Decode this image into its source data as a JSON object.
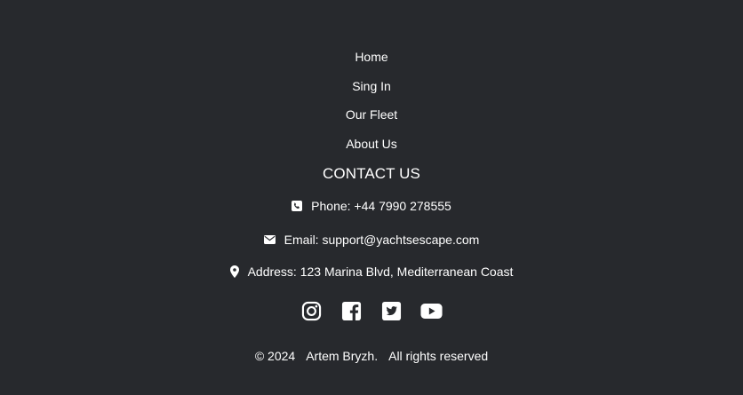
{
  "nav": {
    "items": [
      {
        "label": "Home"
      },
      {
        "label": "Sing In"
      },
      {
        "label": "Our Fleet"
      },
      {
        "label": "About Us"
      }
    ]
  },
  "contact": {
    "title": "CONTACT US",
    "phone": "Phone: +44 7990 278555",
    "email": "Email: support@yachtsescape.com",
    "address": "Address: 123 Marina Blvd, Mediterranean Coast"
  },
  "social": {
    "icons": [
      "instagram-icon",
      "facebook-icon",
      "twitter-icon",
      "youtube-icon"
    ]
  },
  "copyright": {
    "year": "© 2024",
    "author": "Artem Bryzh.",
    "rights": "All rights reserved"
  },
  "colors": {
    "background": "#27292d",
    "text": "#ffffff"
  }
}
